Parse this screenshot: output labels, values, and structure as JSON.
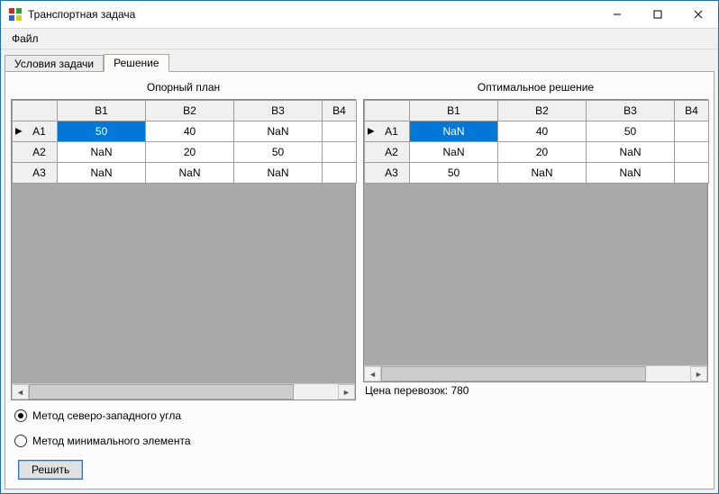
{
  "window": {
    "title": "Транспортная задача"
  },
  "menu": {
    "file": "Файл"
  },
  "tabs": {
    "conditions": "Условия задачи",
    "solution": "Решение"
  },
  "grid_left": {
    "title": "Опорный план",
    "cols": [
      "B1",
      "B2",
      "B3",
      "B4"
    ],
    "rows": [
      "A1",
      "A2",
      "A3"
    ],
    "cells": [
      [
        "50",
        "40",
        "NaN",
        ""
      ],
      [
        "NaN",
        "20",
        "50",
        ""
      ],
      [
        "NaN",
        "NaN",
        "NaN",
        ""
      ]
    ]
  },
  "grid_right": {
    "title": "Оптимальное решение",
    "cols": [
      "B1",
      "B2",
      "B3",
      "B4"
    ],
    "rows": [
      "A1",
      "A2",
      "A3"
    ],
    "cells": [
      [
        "NaN",
        "40",
        "50",
        ""
      ],
      [
        "NaN",
        "20",
        "NaN",
        ""
      ],
      [
        "50",
        "NaN",
        "NaN",
        ""
      ]
    ]
  },
  "price": {
    "label": "Цена перевозок: 780"
  },
  "radios": {
    "nw": "Метод северо-западного угла",
    "min": "Метод минимального элемента"
  },
  "buttons": {
    "solve": "Решить"
  }
}
